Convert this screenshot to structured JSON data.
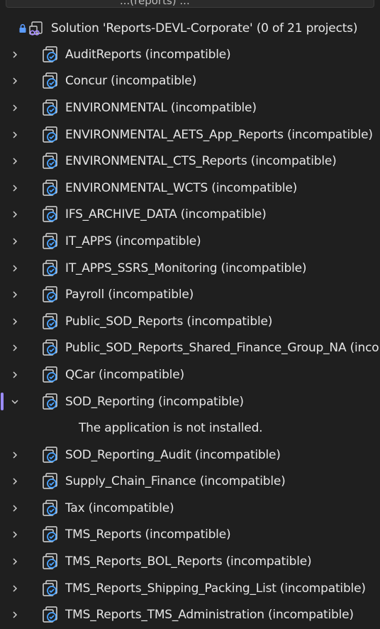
{
  "window": {
    "top_strip_text": "...(reports) ..."
  },
  "solution": {
    "label": "Solution 'Reports-DEVL-Corporate' (0 of 21 projects)",
    "icons": [
      "lock-icon",
      "solution-icon"
    ]
  },
  "projects": [
    {
      "label": "AuditReports (incompatible)",
      "expanded": false
    },
    {
      "label": "Concur (incompatible)",
      "expanded": false
    },
    {
      "label": "ENVIRONMENTAL (incompatible)",
      "expanded": false
    },
    {
      "label": "ENVIRONMENTAL_AETS_App_Reports (incompatible)",
      "expanded": false
    },
    {
      "label": "ENVIRONMENTAL_CTS_Reports (incompatible)",
      "expanded": false
    },
    {
      "label": "ENVIRONMENTAL_WCTS (incompatible)",
      "expanded": false
    },
    {
      "label": "IFS_ARCHIVE_DATA (incompatible)",
      "expanded": false
    },
    {
      "label": "IT_APPS (incompatible)",
      "expanded": false
    },
    {
      "label": "IT_APPS_SSRS_Monitoring (incompatible)",
      "expanded": false
    },
    {
      "label": "Payroll (incompatible)",
      "expanded": false
    },
    {
      "label": "Public_SOD_Reports (incompatible)",
      "expanded": false
    },
    {
      "label": "Public_SOD_Reports_Shared_Finance_Group_NA (inco",
      "expanded": false
    },
    {
      "label": "QCar (incompatible)",
      "expanded": false
    },
    {
      "label": "SOD_Reporting (incompatible)",
      "expanded": true,
      "message": "The application is not installed."
    },
    {
      "label": "SOD_Reporting_Audit (incompatible)",
      "expanded": false
    },
    {
      "label": "Supply_Chain_Finance (incompatible)",
      "expanded": false
    },
    {
      "label": "Tax (incompatible)",
      "expanded": false
    },
    {
      "label": "TMS_Reports (incompatible)",
      "expanded": false
    },
    {
      "label": "TMS_Reports_BOL_Reports (incompatible)",
      "expanded": false
    },
    {
      "label": "TMS_Reports_Shipping_Packing_List (incompatible)",
      "expanded": false
    },
    {
      "label": "TMS_Reports_TMS_Administration (incompatible)",
      "expanded": false
    }
  ],
  "colors": {
    "background": "#1f1f1f",
    "text": "#e6e6e6",
    "selection_accent": "#9b8cff",
    "icon_blue": "#4aa3ff"
  }
}
